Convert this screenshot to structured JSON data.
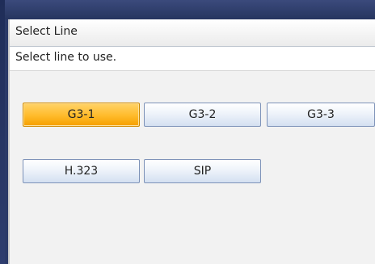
{
  "dialog": {
    "title": "Select Line",
    "instruction": "Select line to use."
  },
  "lines": [
    {
      "label": "G3-1",
      "selected": true
    },
    {
      "label": "G3-2",
      "selected": false
    },
    {
      "label": "G3-3",
      "selected": false
    },
    {
      "label": "H.323",
      "selected": false
    },
    {
      "label": "SIP",
      "selected": false
    }
  ],
  "colors": {
    "selected_button": "#ffbb2a",
    "button_border": "#7d92b8",
    "background_frame": "#2b3a68",
    "panel_background": "#f2f2f2"
  }
}
